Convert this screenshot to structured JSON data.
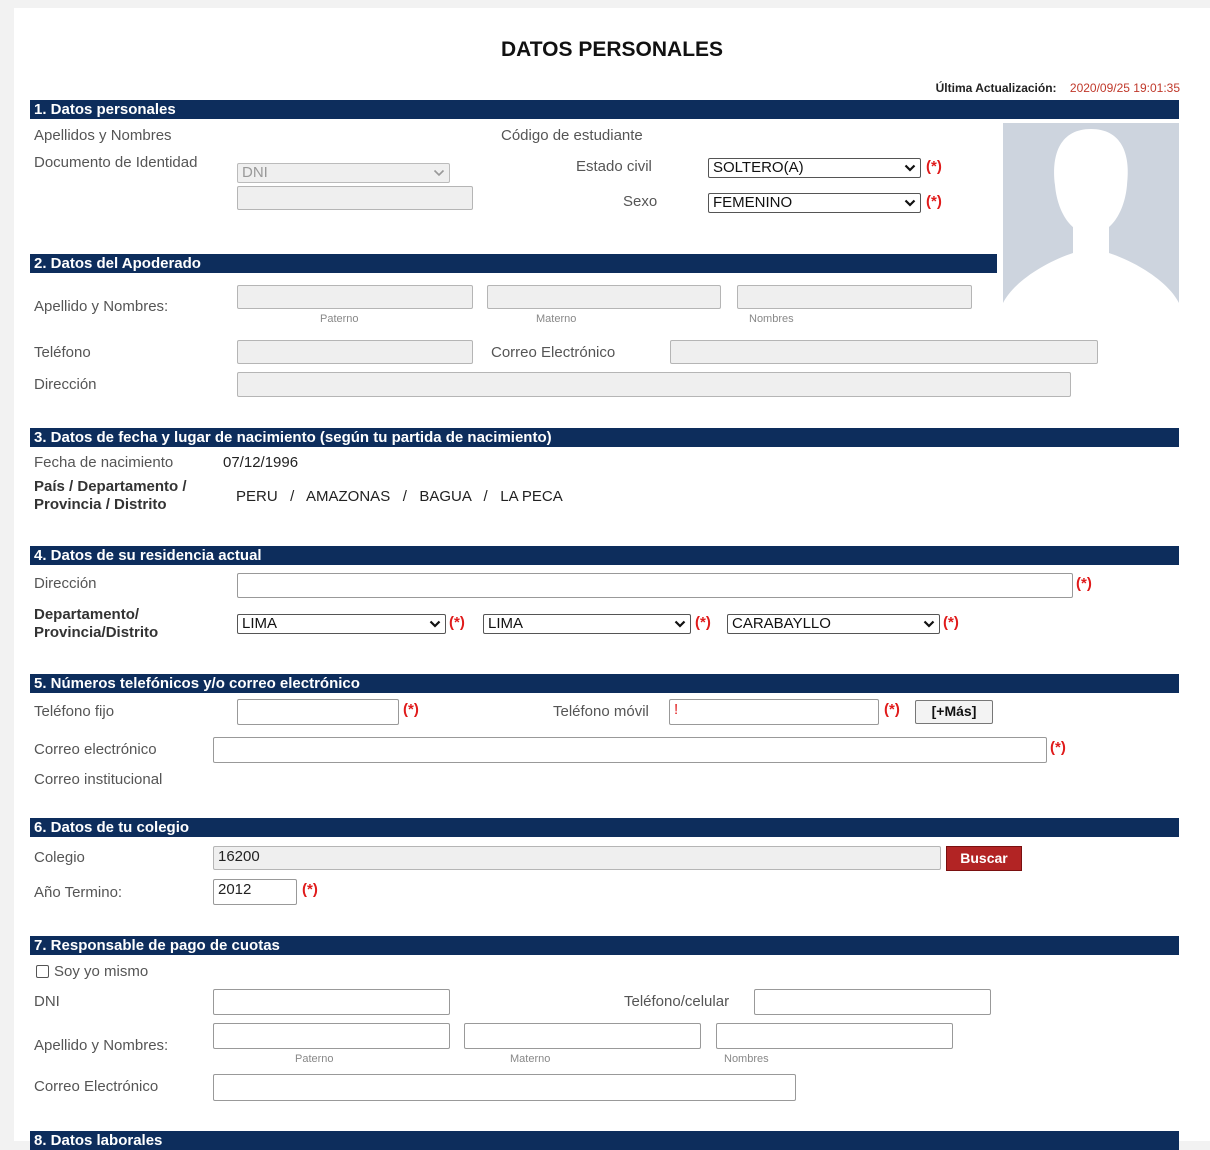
{
  "title": "DATOS PERSONALES",
  "last_update": {
    "label": "Última Actualización:",
    "value": "2020/09/25 19:01:35"
  },
  "required_mark": "(*)",
  "s1": {
    "header": "1. Datos personales",
    "names_label": "Apellidos y Nombres",
    "doc_label": "Documento de Identidad",
    "doc_type": "DNI",
    "student_code_label": "Código de estudiante",
    "civil_label": "Estado civil",
    "civil_value": "SOLTERO(A)",
    "sex_label": "Sexo",
    "sex_value": "FEMENINO"
  },
  "s2": {
    "header": "2. Datos del Apoderado",
    "name_label": "Apellido y Nombres:",
    "paterno": "Paterno",
    "materno": "Materno",
    "nombres": "Nombres",
    "phone_label": "Teléfono",
    "email_label": "Correo Electrónico",
    "address_label": "Dirección"
  },
  "s3": {
    "header": "3. Datos de fecha y lugar de nacimiento (según tu partida de nacimiento)",
    "birth_label": "Fecha de nacimiento",
    "birth_value": "07/12/1996",
    "place_label": "País / Departamento / Provincia / Distrito",
    "place_value": "PERU   /   AMAZONAS   /   BAGUA   /   LA PECA"
  },
  "s4": {
    "header": "4. Datos de su residencia actual",
    "address_label": "Dirección",
    "dept_label": "Departamento/ Provincia/Distrito",
    "dept": "LIMA",
    "prov": "LIMA",
    "dist": "CARABAYLLO"
  },
  "s5": {
    "header": "5. Números telefónicos y/o correo electrónico",
    "landline_label": "Teléfono fijo",
    "mobile_label": "Teléfono móvil",
    "mobile_value": "!",
    "more_button": "[+Más]",
    "email_label": "Correo electrónico",
    "inst_email_label": "Correo institucional"
  },
  "s6": {
    "header": "6. Datos de tu colegio",
    "school_label": "Colegio",
    "school_value": "16200",
    "search_button": "Buscar",
    "year_label": "Año Termino:",
    "year_value": "2012"
  },
  "s7": {
    "header": "7. Responsable de pago de cuotas",
    "self_label": "Soy yo mismo",
    "dni_label": "DNI",
    "phone_label": "Teléfono/celular",
    "name_label": "Apellido y Nombres:",
    "paterno": "Paterno",
    "materno": "Materno",
    "nombres": "Nombres",
    "email_label": "Correo Electrónico"
  },
  "s8": {
    "header": "8. Datos laborales"
  },
  "colors": {
    "section_bg": "#0d2d5c",
    "required": "#e01b1b",
    "button_red": "#b22424"
  }
}
